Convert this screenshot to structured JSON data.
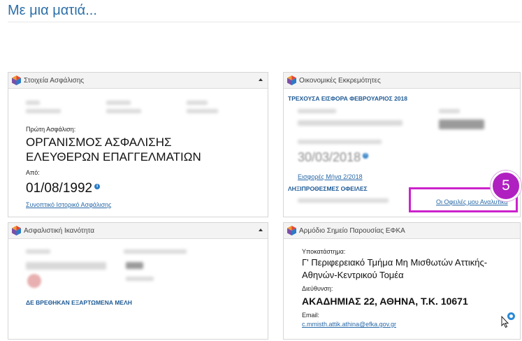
{
  "page_title": "Με μια ματιά...",
  "insurance_panel": {
    "title": "Στοιχεία Ασφάλισης",
    "first_insurance_label": "Πρώτη Ασφάλιση:",
    "fund_name": "ΟΡΓΑΝΙΣΜΟΣ ΑΣΦΑΛΙΣΗΣ ΕΛΕΥΘΕΡΩΝ ΕΠΑΓΓΕΛΜΑΤΙΩΝ",
    "from_label": "Από:",
    "from_date": "01/08/1992",
    "history_link": "Συνοπτικό Ιστορικό Ασφάλισης"
  },
  "financial_panel": {
    "title": "Οικονομικές Εκκρεμότητες",
    "current_contribution": "ΤΡΕΧΟΥΣΑ ΕΙΣΦΟΡΑ ΦΕΒΡΟΥΑΡΙΟΣ 2018",
    "due_date": "30/03/2018",
    "month_contributions_link": "Εισφορές Μήνα 2/2018",
    "overdue_head": "ΛΗΞΙΠΡΟΘΕΣΜΕΣ ΟΦΕΙΛΕΣ",
    "debts_link": "Οι Οφειλές μου Αναλυτικά"
  },
  "capacity_panel": {
    "title": "Ασφαλιστική Ικανότητα",
    "dependents_text": "ΔΕ ΒΡΕΘΗΚΑΝ ΕΞΑΡΤΩΜΕΝΑ ΜΕΛΗ"
  },
  "efka_panel": {
    "title": "Αρμόδιο Σημείο Παρουσίας ΕΦΚΑ",
    "branch_label": "Υποκατάστημα:",
    "branch_name": "Γ' Περιφερειακό Τμήμα Μη Μισθωτών Αττικής-Αθηνών-Κεντρικού Τομέα",
    "address_label": "Διεύθυνση:",
    "address": "ΑΚΑΔΗΜΙΑΣ 22, ΑΘΗΝΑ, Τ.Κ. 10671",
    "email_label": "Email:",
    "email": "c.mmisth.attik.athina@efka.gov.gr"
  },
  "step_badge": "5",
  "colors": {
    "accent": "#2c6fa8",
    "highlight": "#cc22cc",
    "badge": "#b020c0"
  }
}
